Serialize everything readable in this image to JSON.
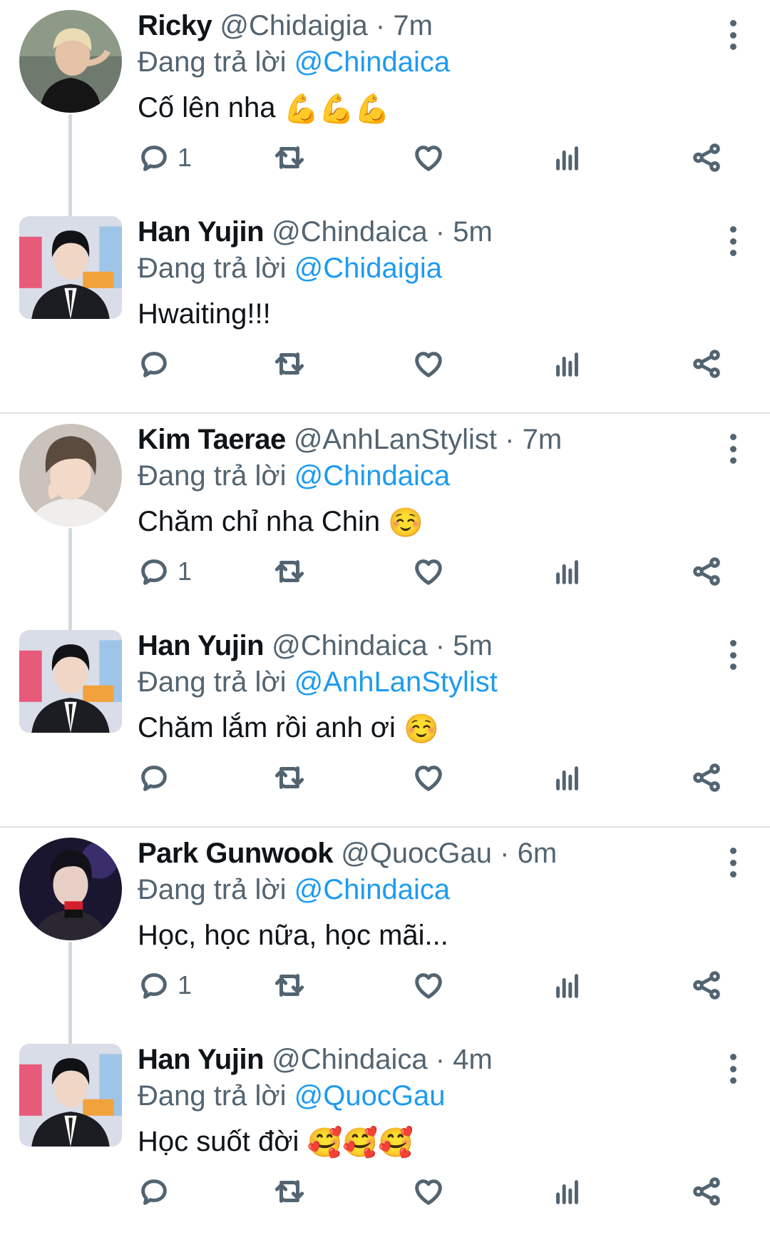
{
  "reply_prefix": "Đang trả lời",
  "threads": [
    {
      "tweets": [
        {
          "name": "Ricky",
          "handle": "@Chidaigia",
          "dot": "·",
          "time": "7m",
          "mention": "@Chindaica",
          "text": "Cố lên nha",
          "emoji": "💪💪💪",
          "reply_count": "1"
        },
        {
          "name": "Han Yujin",
          "handle": "@Chindaica",
          "dot": "·",
          "time": "5m",
          "mention": "@Chidaigia",
          "text": "Hwaiting!!!",
          "emoji": "",
          "reply_count": ""
        }
      ]
    },
    {
      "tweets": [
        {
          "name": "Kim Taerae",
          "handle": "@AnhLanStylist",
          "dot": "·",
          "time": "7m",
          "mention": "@Chindaica",
          "text": "Chăm chỉ nha Chin",
          "emoji": "☺️",
          "reply_count": "1"
        },
        {
          "name": "Han Yujin",
          "handle": "@Chindaica",
          "dot": "·",
          "time": "5m",
          "mention": "@AnhLanStylist",
          "text": "Chăm lắm rồi anh ơi",
          "emoji": "☺️",
          "reply_count": ""
        }
      ]
    },
    {
      "tweets": [
        {
          "name": "Park Gunwook",
          "handle": "@QuocGau",
          "dot": "·",
          "time": "6m",
          "mention": "@Chindaica",
          "text": "Học, học nữa, học mãi...",
          "emoji": "",
          "reply_count": "1"
        },
        {
          "name": "Han Yujin",
          "handle": "@Chindaica",
          "dot": "·",
          "time": "4m",
          "mention": "@QuocGau",
          "text": "Học suốt đời",
          "emoji": "🥰🥰🥰",
          "reply_count": ""
        }
      ]
    }
  ],
  "colors": {
    "mention": "#1d9bf0",
    "secondary_text": "#536471",
    "divider": "#e1e5e8"
  },
  "icons": [
    "reply-icon",
    "retweet-icon",
    "like-icon",
    "views-icon",
    "share-icon",
    "more-icon"
  ]
}
